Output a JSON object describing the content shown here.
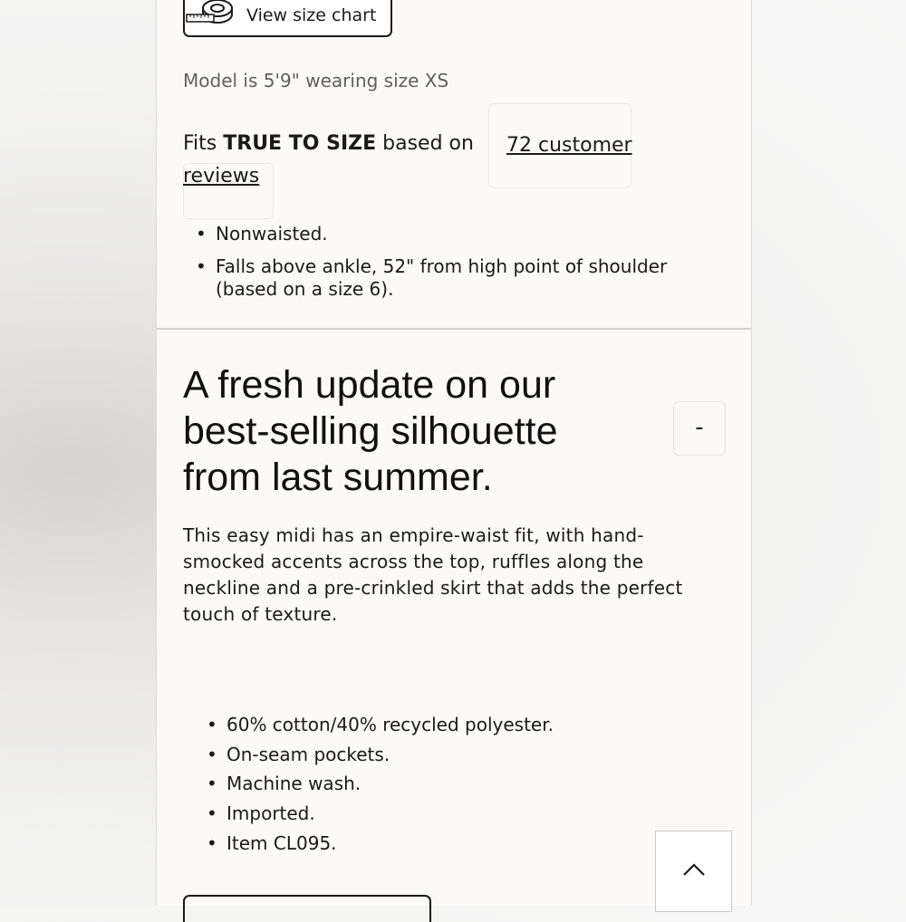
{
  "size_chart": {
    "label": "View size chart",
    "icon": "tape-measure-icon"
  },
  "model_note": "Model is 5'9\" wearing size XS",
  "fit": {
    "prefix": "Fits ",
    "emphasis": "TRUE TO SIZE",
    "suffix": " based on",
    "reviews_link_part1": "72 customer",
    "reviews_link_part2": "reviews"
  },
  "fit_details": [
    "Nonwaisted.",
    "Falls above ankle, 52\" from high point of shoulder (based on a size 6)."
  ],
  "description": {
    "heading": "A fresh update on our best-selling silhouette from last summer.",
    "collapse_label": "-",
    "body": "This easy midi has an empire-waist fit, with hand-smocked accents across the top, ruffles along the neckline and a pre-crinkled skirt that adds the perfect touch of texture."
  },
  "details": [
    "60% cotton/40% recycled polyester.",
    "On-seam pockets.",
    "Machine wash.",
    "Imported.",
    "Item CL095."
  ],
  "back_to_top": {
    "icon": "chevron-up-icon"
  }
}
